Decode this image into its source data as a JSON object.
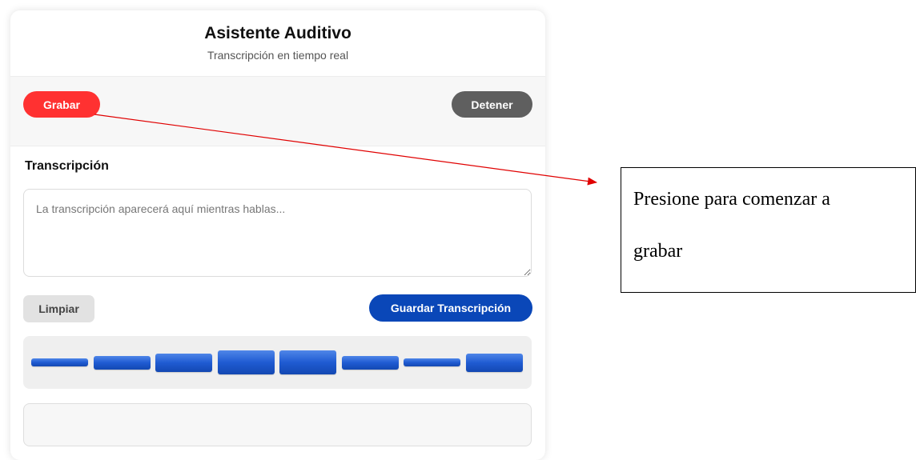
{
  "app": {
    "title": "Asistente Auditivo",
    "subtitle": "Transcripción en tiempo real"
  },
  "controls": {
    "record_label": "Grabar",
    "stop_label": "Detener"
  },
  "transcription": {
    "section_title": "Transcripción",
    "placeholder": "La transcripción aparecerá aquí mientras hablas...",
    "value": ""
  },
  "actions": {
    "clear_label": "Limpiar",
    "save_label": "Guardar Transcripción"
  },
  "visualizer": {
    "levels": [
      0.15,
      0.25,
      0.35,
      0.45,
      0.45,
      0.25,
      0.15,
      0.35
    ]
  },
  "annotation": {
    "line1": "Presione para comenzar a",
    "line2": "grabar"
  },
  "colors": {
    "record": "#ff3131",
    "stop": "#5f5f5f",
    "save": "#0a47b8",
    "visualizer_bar": "#1f5bd2",
    "arrow": "#e00000"
  }
}
